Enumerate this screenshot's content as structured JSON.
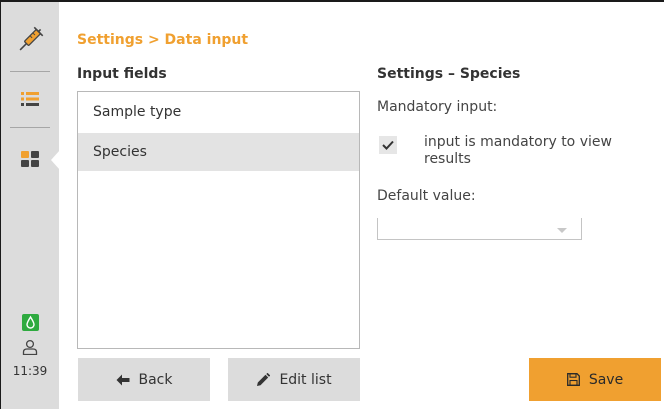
{
  "header": {
    "breadcrumb": "Settings > Data input"
  },
  "sidebar": {
    "items": [
      {
        "icon": "syringe-icon"
      },
      {
        "icon": "list-icon"
      },
      {
        "icon": "grid-icon",
        "active": true
      },
      {
        "icon": "drop-icon"
      },
      {
        "icon": "user-icon"
      }
    ],
    "time": "11:39"
  },
  "input_fields": {
    "title": "Input fields",
    "items": [
      "Sample type",
      "Species"
    ],
    "selected": "Species"
  },
  "settings_panel": {
    "title": "Settings – Species",
    "mandatory_label": "Mandatory input:",
    "mandatory_checked": true,
    "mandatory_checkbox_text": "input is mandatory to view results",
    "default_label": "Default value:",
    "default_value": ""
  },
  "buttons": {
    "back": "Back",
    "edit_list": "Edit list",
    "save": "Save"
  },
  "colors": {
    "accent": "#f0a030",
    "sidebar_bg": "#dcdcdc",
    "selected_row": "#e3e3e3",
    "drop_icon_green": "#2eaa3f",
    "list_icon_orange": "#f0a030"
  }
}
